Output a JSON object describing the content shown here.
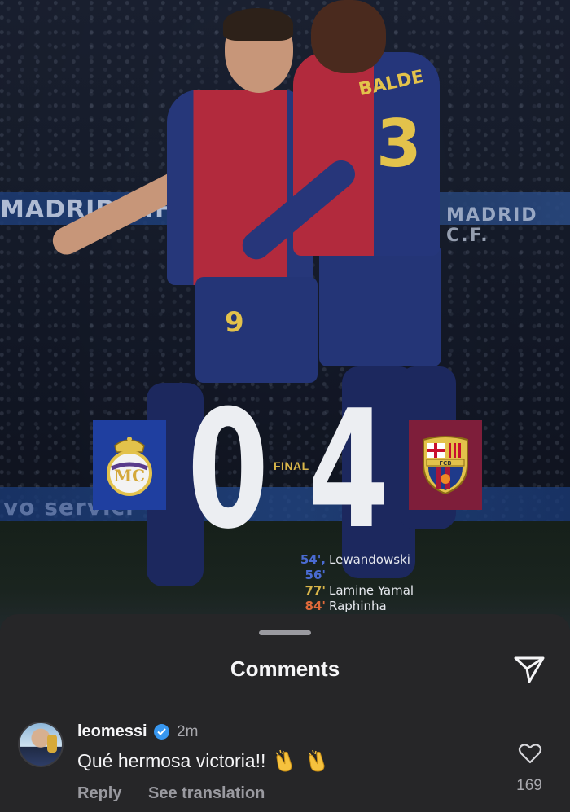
{
  "hero": {
    "stand_text_left": "MADRID C.F",
    "stand_text_right": "MADRID C.F.",
    "ad_text": "vo servici",
    "player_back_name": "BALDE",
    "player_back_number": "3",
    "player_front_number": "9"
  },
  "match": {
    "home_team_icon": "real-madrid-crest-icon",
    "away_team_icon": "fc-barcelona-crest-icon",
    "home_score": "0",
    "away_score": "4",
    "status": "FINAL",
    "crest_home_color": "#1f3fa0",
    "crest_away_color": "#7e1e3a",
    "scorers": [
      {
        "minutes": "54', 56'",
        "name": "Lewandowski"
      },
      {
        "minutes": "77'",
        "name": "Lamine Yamal"
      },
      {
        "minutes": "84'",
        "name": "Raphinha"
      }
    ]
  },
  "comments_sheet": {
    "title": "Comments",
    "send_icon": "send-icon",
    "comment": {
      "username": "leomessi",
      "verified": true,
      "time": "2m",
      "text": "Qué hermosa victoria!!",
      "emoji_icon": "clapping-hands-icon",
      "reply_label": "Reply",
      "translate_label": "See translation",
      "like_icon": "heart-icon",
      "like_count": "169"
    }
  }
}
